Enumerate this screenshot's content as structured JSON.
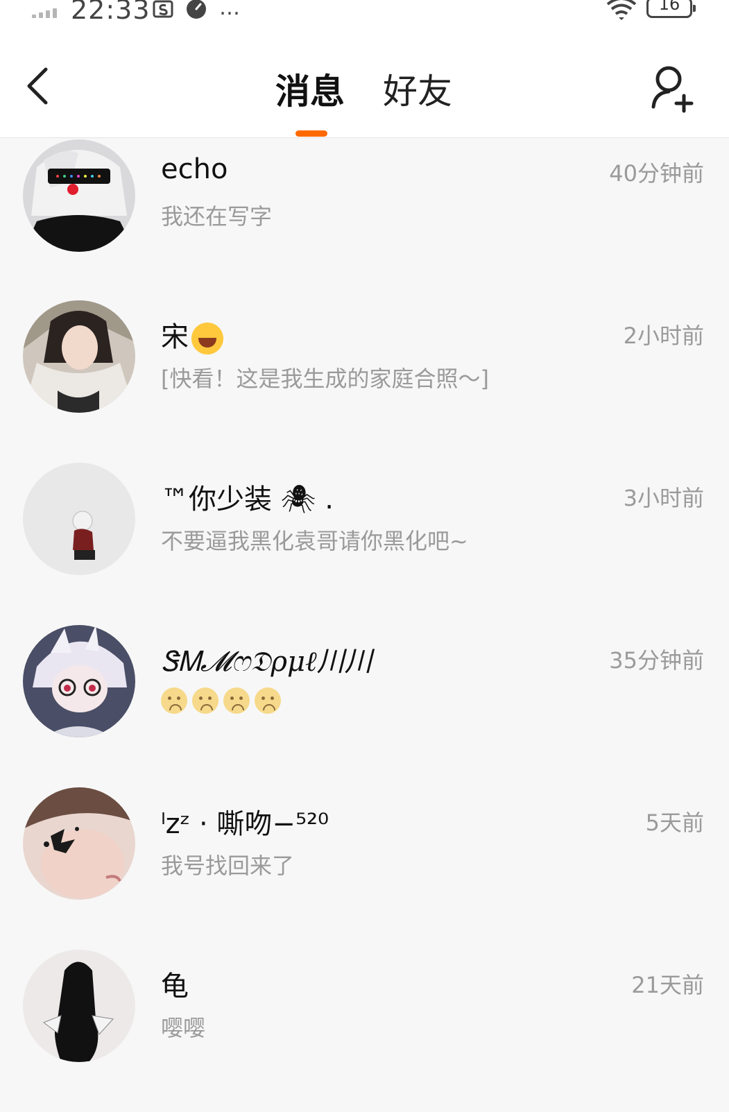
{
  "status_bar": {
    "time": "22:33",
    "more": "…",
    "battery": "16"
  },
  "header": {
    "tabs": [
      {
        "label": "消息",
        "active": true
      },
      {
        "label": "好友",
        "active": false
      }
    ],
    "accent_color": "#ff6a00"
  },
  "conversations": [
    {
      "name": "echo",
      "preview": "我还在写字",
      "time": "40分钟前"
    },
    {
      "name": "宋",
      "preview": "[快看！这是我生成的家庭合照～]",
      "time": "2小时前"
    },
    {
      "name": "™你少装 🕷 .",
      "preview": "不要逼我黑化袁哥请你黑化吧~",
      "time": "3小时前"
    },
    {
      "name": "ᏕᎷ𝓜ෆ𝔇ρμℓ川川 ",
      "preview": "",
      "time": "35分钟前"
    },
    {
      "name": "ˡzᶻ · 嘶吻−⁵²⁰",
      "preview": "我号找回来了",
      "time": "5天前"
    },
    {
      "name": "龟",
      "preview": "嘤嘤",
      "time": "21天前"
    }
  ]
}
